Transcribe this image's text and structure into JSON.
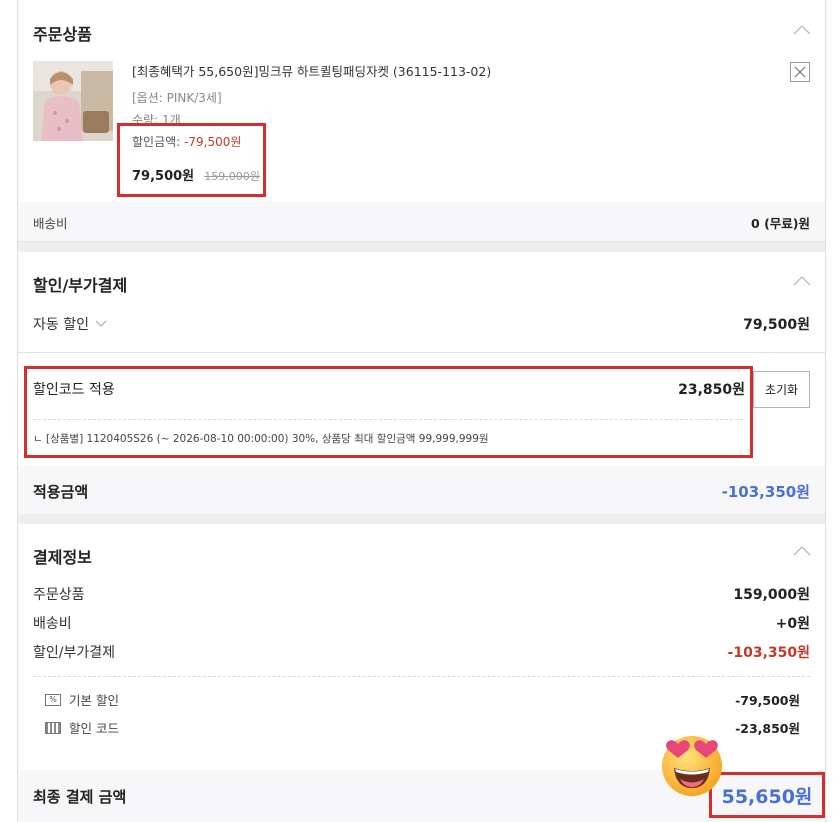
{
  "order": {
    "title": "주문상품",
    "product": {
      "name": "[최종혜택가 55,650원]밍크뮤 하트퀼팅패딩자켓 (36115-113-02)",
      "option": "[옵션: PINK/3세]",
      "quantity": "수량: 1개",
      "discount_label": "할인금액:",
      "discount_value": "-79,500원",
      "price": "79,500원",
      "original_price": "159,000원"
    },
    "shipping_label": "배송비",
    "shipping_value": "0 (무료)원"
  },
  "discount": {
    "title": "할인/부가결제",
    "auto_label": "자동 할인",
    "auto_value": "79,500원",
    "code_label": "할인코드 적용",
    "code_value": "23,850원",
    "reset_label": "초기화",
    "code_detail": "ㄴ [상품별] 1120405S26 (~ 2026-08-10 00:00:00) 30%, 상품당 최대 할인금액 99,999,999원",
    "applied_label": "적용금액",
    "applied_value": "-103,350원"
  },
  "payment": {
    "title": "결제정보",
    "rows": [
      {
        "label": "주문상품",
        "value": "159,000원"
      },
      {
        "label": "배송비",
        "value": "+0원"
      },
      {
        "label": "할인/부가결제",
        "value": "-103,350원"
      }
    ],
    "sub_rows": [
      {
        "icon_text": "%",
        "label": "기본 할인",
        "value": "-79,500원"
      },
      {
        "icon_text": "",
        "label": "할인 코드",
        "value": "-23,850원"
      }
    ],
    "final_label": "최종 결제 금액",
    "final_value": "55,650원"
  },
  "colors": {
    "accent_blue": "#4a6fd6",
    "negative_red": "#c0392b",
    "highlight_box": "#d32f2f"
  },
  "icons": {
    "collapse": "chevron-up-icon",
    "remove": "close-icon",
    "emoji": "heart-eyes-emoji"
  }
}
